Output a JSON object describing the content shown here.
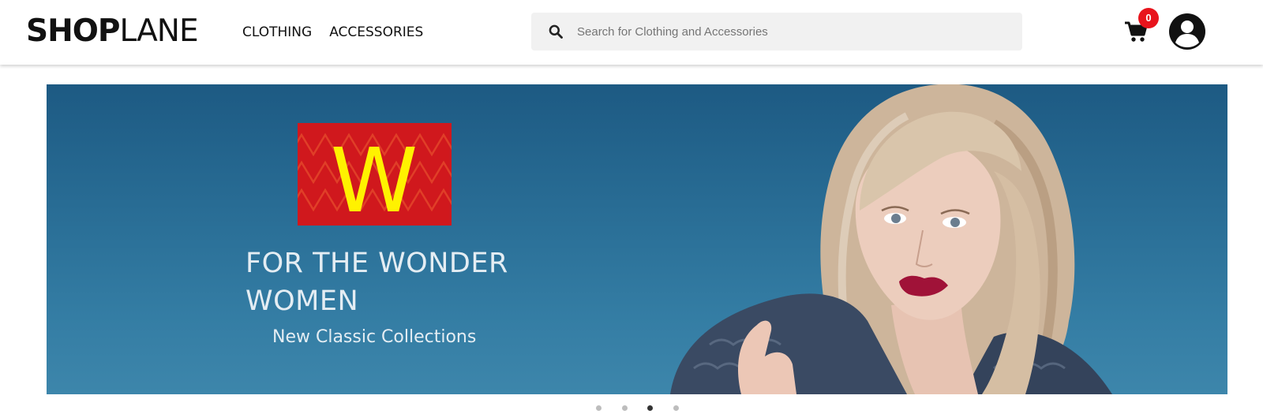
{
  "header": {
    "logo_bold": "SHOP",
    "logo_light": "LANE",
    "nav": [
      "CLOTHING",
      "ACCESSORIES"
    ],
    "search": {
      "placeholder": "Search for Clothing and Accessories",
      "value": ""
    },
    "cart_count": "0",
    "icons": {
      "search": "search-icon",
      "cart": "cart-icon",
      "user": "user-icon"
    },
    "colors": {
      "badge": "#e8141c"
    }
  },
  "banner": {
    "brand_letter": "W",
    "headline_line1": "FOR THE WONDER",
    "headline_line2": "WOMEN",
    "subline": "New Classic Collections",
    "colors": {
      "background": "#2a6f97",
      "brand_red": "#d0181d",
      "brand_yellow": "#fff200"
    }
  },
  "carousel": {
    "slide_count": 4,
    "active_index": 2
  }
}
